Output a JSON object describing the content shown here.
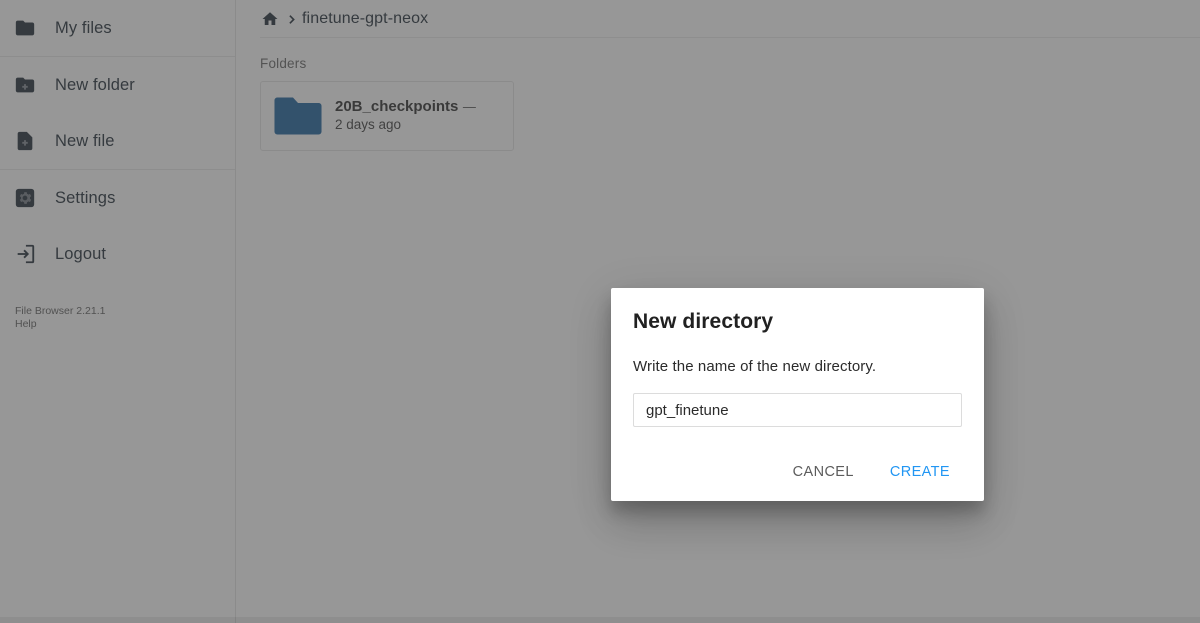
{
  "app": {
    "name": "File Browser",
    "accent_color": "#2196f3",
    "folder_icon_color": "#2c6ca3",
    "sidebar_text_color": "#2f3b44"
  },
  "sidebar": {
    "items": [
      {
        "label": "My files",
        "icon": "folder-icon"
      },
      {
        "label": "New folder",
        "icon": "folder-plus-icon"
      },
      {
        "label": "New file",
        "icon": "file-plus-icon"
      },
      {
        "label": "Settings",
        "icon": "gear-icon"
      },
      {
        "label": "Logout",
        "icon": "logout-icon"
      }
    ],
    "footer": {
      "version": "File Browser 2.21.1",
      "help": "Help"
    }
  },
  "breadcrumb": {
    "home_icon": "home-icon",
    "separator": "›",
    "path": "finetune-gpt-neox"
  },
  "listing": {
    "section_title": "Folders",
    "items": [
      {
        "name": "20B_checkpoints",
        "size": "—",
        "modified": "2 days ago",
        "icon": "folder-icon"
      }
    ]
  },
  "dialog": {
    "title": "New directory",
    "description": "Write the name of the new directory.",
    "input": {
      "value": "gpt_finetune",
      "placeholder": ""
    },
    "cancel_label": "CANCEL",
    "create_label": "CREATE"
  }
}
